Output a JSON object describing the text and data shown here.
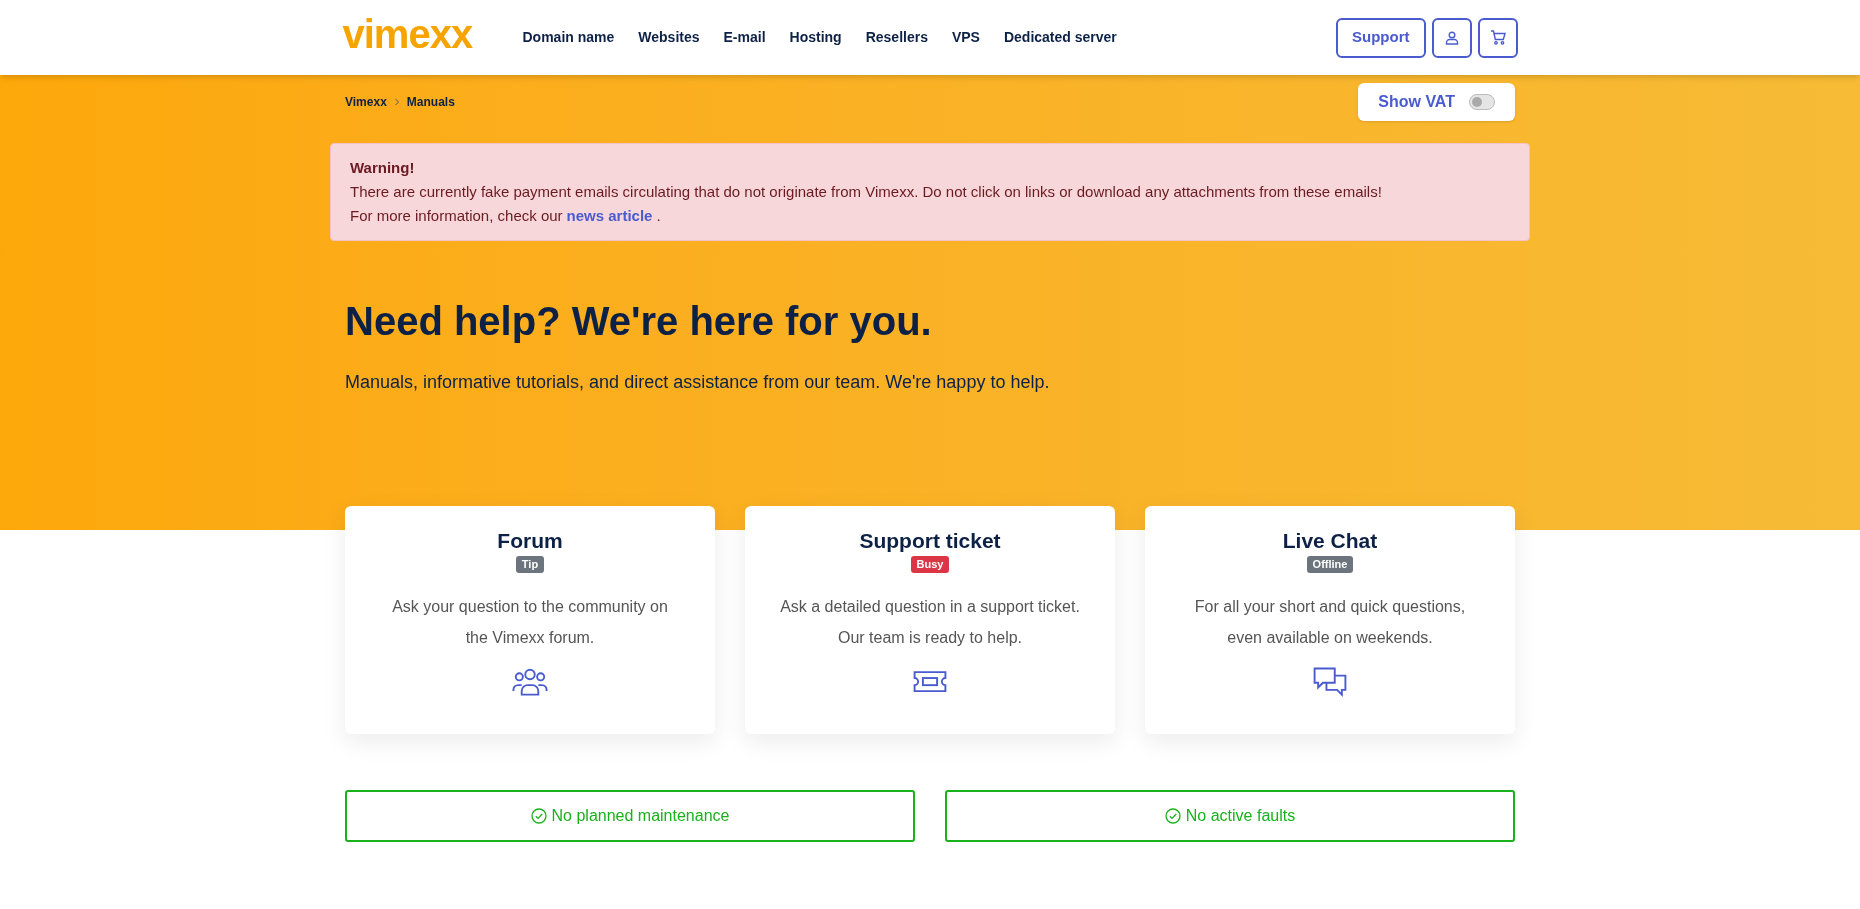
{
  "header": {
    "logo": "vimexx",
    "nav": [
      "Domain name",
      "Websites",
      "E-mail",
      "Hosting",
      "Resellers",
      "VPS",
      "Dedicated server"
    ],
    "support_button": "Support"
  },
  "breadcrumb": [
    "Vimexx",
    "Manuals"
  ],
  "vat_toggle": {
    "label": "Show VAT",
    "on": false
  },
  "warning": {
    "title": "Warning!",
    "text": "There are currently fake payment emails circulating that do not originate from Vimexx. Do not click on links or download any attachments from these emails!",
    "more_before": "For more information, check our",
    "link": "news article",
    "more_after": "."
  },
  "hero": {
    "title": "Need help? We're here for you.",
    "subtitle": "Manuals, informative tutorials, and direct assistance from our team. We're happy to help."
  },
  "cards": [
    {
      "kind": "forum",
      "title": "Forum",
      "badge": "Tip",
      "color": "#6c757d",
      "text": "Ask your question to the community on the Vimexx forum."
    },
    {
      "kind": "ticket",
      "title": "Support ticket",
      "badge": "Busy",
      "color": "#dc3545",
      "text": "Ask a detailed question in a support ticket. Our team is ready to help."
    },
    {
      "kind": "chat",
      "title": "Live Chat",
      "badge": "Offline",
      "color": "#6c757d",
      "text": "For all your short and quick questions, even available on weekends."
    }
  ],
  "status": [
    "No planned maintenance",
    "No active faults"
  ]
}
